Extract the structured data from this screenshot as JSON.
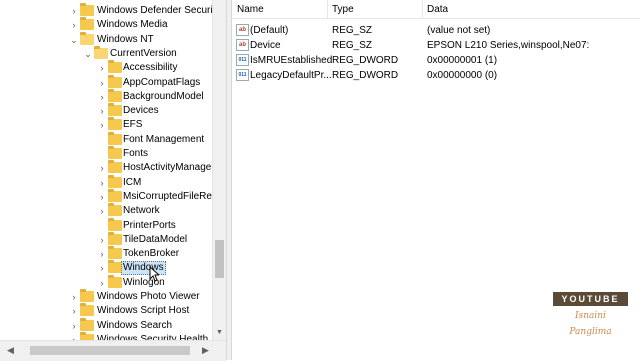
{
  "tree": {
    "nodes": [
      {
        "label": "Windows Defender Security",
        "level": 0,
        "expanded": false,
        "open": false,
        "selected": false
      },
      {
        "label": "Windows Media",
        "level": 0,
        "expanded": false,
        "open": false,
        "selected": false
      },
      {
        "label": "Windows NT",
        "level": 0,
        "expanded": true,
        "open": true,
        "selected": false
      },
      {
        "label": "CurrentVersion",
        "level": 1,
        "expanded": true,
        "open": true,
        "selected": false
      },
      {
        "label": "Accessibility",
        "level": 2,
        "expanded": false,
        "open": false,
        "selected": false
      },
      {
        "label": "AppCompatFlags",
        "level": 2,
        "expanded": false,
        "open": false,
        "selected": false
      },
      {
        "label": "BackgroundModel",
        "level": 2,
        "expanded": false,
        "open": false,
        "selected": false
      },
      {
        "label": "Devices",
        "level": 2,
        "expanded": false,
        "open": false,
        "selected": false
      },
      {
        "label": "EFS",
        "level": 2,
        "expanded": false,
        "open": false,
        "selected": false
      },
      {
        "label": "Font Management",
        "level": 2,
        "expanded": null,
        "open": false,
        "selected": false
      },
      {
        "label": "Fonts",
        "level": 2,
        "expanded": null,
        "open": false,
        "selected": false
      },
      {
        "label": "HostActivityManager",
        "level": 2,
        "expanded": false,
        "open": false,
        "selected": false
      },
      {
        "label": "ICM",
        "level": 2,
        "expanded": false,
        "open": false,
        "selected": false
      },
      {
        "label": "MsiCorruptedFileReco",
        "level": 2,
        "expanded": false,
        "open": false,
        "selected": false
      },
      {
        "label": "Network",
        "level": 2,
        "expanded": false,
        "open": false,
        "selected": false
      },
      {
        "label": "PrinterPorts",
        "level": 2,
        "expanded": null,
        "open": false,
        "selected": false
      },
      {
        "label": "TileDataModel",
        "level": 2,
        "expanded": false,
        "open": false,
        "selected": false
      },
      {
        "label": "TokenBroker",
        "level": 2,
        "expanded": false,
        "open": false,
        "selected": false
      },
      {
        "label": "Windows",
        "level": 2,
        "expanded": false,
        "open": false,
        "selected": true
      },
      {
        "label": "Winlogon",
        "level": 2,
        "expanded": false,
        "open": false,
        "selected": false
      },
      {
        "label": "Windows Photo Viewer",
        "level": 0,
        "expanded": false,
        "open": false,
        "selected": false
      },
      {
        "label": "Windows Script Host",
        "level": 0,
        "expanded": false,
        "open": false,
        "selected": false
      },
      {
        "label": "Windows Search",
        "level": 0,
        "expanded": false,
        "open": false,
        "selected": false
      },
      {
        "label": "Windows Security Health",
        "level": 0,
        "expanded": false,
        "open": false,
        "selected": false
      }
    ]
  },
  "values": {
    "columns": [
      "Name",
      "Type",
      "Data"
    ],
    "rows": [
      {
        "icon": "string-value-icon",
        "glyph": "ab",
        "name": "(Default)",
        "type": "REG_SZ",
        "data": "(value not set)"
      },
      {
        "icon": "string-value-icon",
        "glyph": "ab",
        "name": "Device",
        "type": "REG_SZ",
        "data": "EPSON L210 Series,winspool,Ne07:"
      },
      {
        "icon": "dword-value-icon",
        "glyph": "011",
        "name": "IsMRUEstablished",
        "type": "REG_DWORD",
        "data": "0x00000001 (1)"
      },
      {
        "icon": "dword-value-icon",
        "glyph": "011",
        "name": "LegacyDefaultPr...",
        "type": "REG_DWORD",
        "data": "0x00000000 (0)"
      }
    ]
  },
  "overlay": {
    "badge_top": "YOUTUBE",
    "badge_name": "Isnaini Panglima"
  },
  "colors": {
    "folder": "#f6c84e",
    "selection": "#cce4f7",
    "badge_bg": "#5b4a36",
    "badge_name": "#c98a4b"
  }
}
